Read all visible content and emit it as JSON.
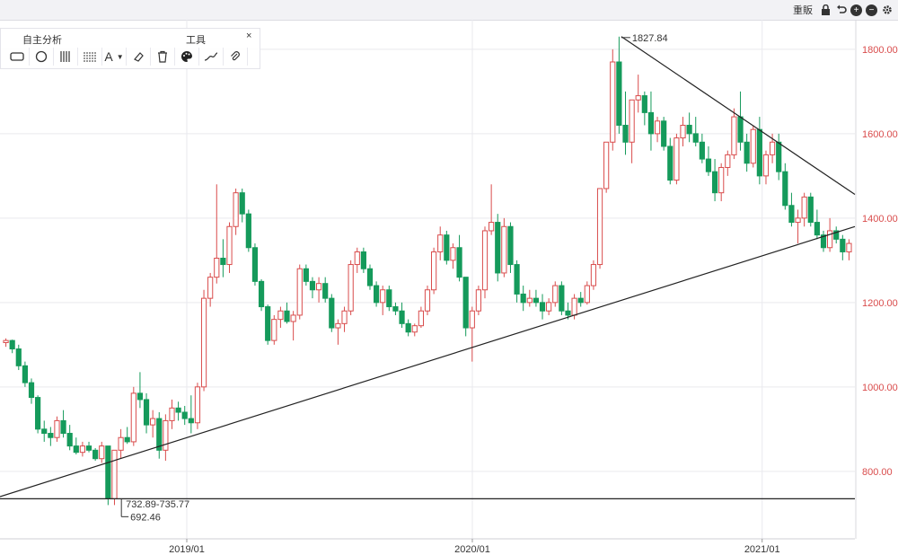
{
  "toolbar": {
    "title": "自主分析",
    "label": "工具",
    "close": "×",
    "tools": [
      {
        "icon": "rectangle-icon"
      },
      {
        "icon": "circle-icon"
      },
      {
        "icon": "vertical-lines-icon"
      },
      {
        "icon": "horizontal-lines-icon"
      },
      {
        "icon": "text-icon",
        "text": "A"
      },
      {
        "icon": "dropdown-arrow-icon",
        "text": "▼"
      },
      {
        "icon": "eraser-icon"
      },
      {
        "icon": "trash-icon"
      },
      {
        "icon": "palette-icon"
      },
      {
        "icon": "line-style-icon"
      },
      {
        "icon": "attach-icon"
      }
    ]
  },
  "topbar": {
    "label": "重販",
    "icons": [
      "lock-icon",
      "undo-icon",
      "zoom-in-icon",
      "zoom-out-icon",
      "settings-icon"
    ]
  },
  "colors": {
    "up": "#d94c4c",
    "down": "#159a5b",
    "axis_text": "#d94c4c",
    "grid": "#e9e9ee",
    "trendline": "#222222"
  },
  "chart_data": {
    "type": "candlestick",
    "x_ticks": [
      "2019/01",
      "2020/01",
      "2021/01"
    ],
    "y_ticks": [
      800,
      1000,
      1200,
      1400,
      1600,
      1800
    ],
    "y_tick_labels": [
      "800.00",
      "1000.00",
      "1200.00",
      "1400.00",
      "1600.00",
      "1800.00"
    ],
    "ylim": [
      640,
      1870
    ],
    "annotations": [
      {
        "text": "1827.84",
        "value": 1827.84,
        "kind": "high"
      },
      {
        "text": "732.89-735.77",
        "value": 734,
        "kind": "horizontal-level"
      },
      {
        "text": "692.46",
        "value": 692.46,
        "kind": "low"
      }
    ],
    "lines": [
      {
        "name": "support-trendline",
        "points": [
          {
            "t": 0,
            "v": 740
          },
          {
            "t": 1,
            "v": 1380
          }
        ]
      },
      {
        "name": "resistance-trendline",
        "points": [
          {
            "t": 0.7268,
            "v": 1830
          },
          {
            "t": 1,
            "v": 1456
          }
        ]
      },
      {
        "name": "horizontal-level",
        "points": [
          {
            "t": 0,
            "v": 735
          },
          {
            "t": 1,
            "v": 735
          }
        ]
      }
    ],
    "candles": [
      [
        1105,
        1115,
        1095,
        1110
      ],
      [
        1110,
        1112,
        1080,
        1090
      ],
      [
        1090,
        1100,
        1040,
        1050
      ],
      [
        1050,
        1060,
        1000,
        1010
      ],
      [
        1010,
        1020,
        960,
        975
      ],
      [
        975,
        980,
        890,
        900
      ],
      [
        900,
        920,
        870,
        890
      ],
      [
        890,
        905,
        860,
        880
      ],
      [
        880,
        930,
        870,
        920
      ],
      [
        920,
        945,
        880,
        890
      ],
      [
        890,
        910,
        850,
        860
      ],
      [
        860,
        880,
        840,
        845
      ],
      [
        845,
        870,
        835,
        860
      ],
      [
        860,
        870,
        845,
        850
      ],
      [
        850,
        855,
        825,
        830
      ],
      [
        830,
        870,
        820,
        860
      ],
      [
        860,
        860,
        720,
        735
      ],
      [
        735,
        850,
        720,
        850
      ],
      [
        850,
        900,
        830,
        880
      ],
      [
        880,
        905,
        865,
        870
      ],
      [
        870,
        1000,
        860,
        985
      ],
      [
        985,
        1035,
        950,
        970
      ],
      [
        970,
        985,
        890,
        910
      ],
      [
        910,
        945,
        880,
        925
      ],
      [
        925,
        940,
        830,
        850
      ],
      [
        850,
        935,
        825,
        920
      ],
      [
        920,
        970,
        900,
        950
      ],
      [
        950,
        965,
        920,
        940
      ],
      [
        940,
        955,
        910,
        925
      ],
      [
        925,
        980,
        890,
        915
      ],
      [
        915,
        1010,
        900,
        1000
      ],
      [
        1000,
        1230,
        990,
        1210
      ],
      [
        1210,
        1270,
        1190,
        1260
      ],
      [
        1260,
        1480,
        1245,
        1305
      ],
      [
        1305,
        1350,
        1260,
        1290
      ],
      [
        1290,
        1390,
        1270,
        1380
      ],
      [
        1380,
        1470,
        1360,
        1460
      ],
      [
        1460,
        1470,
        1390,
        1410
      ],
      [
        1410,
        1420,
        1320,
        1330
      ],
      [
        1330,
        1340,
        1240,
        1250
      ],
      [
        1250,
        1255,
        1180,
        1190
      ],
      [
        1190,
        1195,
        1100,
        1110
      ],
      [
        1110,
        1170,
        1100,
        1160
      ],
      [
        1160,
        1190,
        1140,
        1180
      ],
      [
        1180,
        1200,
        1150,
        1155
      ],
      [
        1155,
        1180,
        1110,
        1170
      ],
      [
        1170,
        1290,
        1160,
        1280
      ],
      [
        1280,
        1290,
        1240,
        1250
      ],
      [
        1250,
        1260,
        1210,
        1230
      ],
      [
        1230,
        1260,
        1200,
        1245
      ],
      [
        1245,
        1260,
        1200,
        1210
      ],
      [
        1210,
        1220,
        1130,
        1140
      ],
      [
        1140,
        1160,
        1100,
        1150
      ],
      [
        1150,
        1190,
        1130,
        1180
      ],
      [
        1180,
        1300,
        1170,
        1290
      ],
      [
        1290,
        1330,
        1270,
        1320
      ],
      [
        1320,
        1330,
        1270,
        1280
      ],
      [
        1280,
        1290,
        1230,
        1240
      ],
      [
        1240,
        1250,
        1190,
        1200
      ],
      [
        1200,
        1240,
        1170,
        1230
      ],
      [
        1230,
        1240,
        1180,
        1190
      ],
      [
        1190,
        1200,
        1170,
        1180
      ],
      [
        1180,
        1200,
        1140,
        1150
      ],
      [
        1150,
        1160,
        1120,
        1130
      ],
      [
        1130,
        1150,
        1120,
        1145
      ],
      [
        1145,
        1190,
        1140,
        1180
      ],
      [
        1180,
        1240,
        1170,
        1230
      ],
      [
        1230,
        1330,
        1220,
        1320
      ],
      [
        1320,
        1380,
        1300,
        1360
      ],
      [
        1360,
        1370,
        1290,
        1300
      ],
      [
        1300,
        1340,
        1280,
        1330
      ],
      [
        1330,
        1360,
        1250,
        1260
      ],
      [
        1260,
        1140,
        1120,
        1140
      ],
      [
        1140,
        1190,
        1060,
        1180
      ],
      [
        1180,
        1240,
        1170,
        1230
      ],
      [
        1230,
        1380,
        1210,
        1370
      ],
      [
        1370,
        1480,
        1360,
        1390
      ],
      [
        1390,
        1410,
        1250,
        1270
      ],
      [
        1270,
        1400,
        1260,
        1380
      ],
      [
        1380,
        1390,
        1270,
        1290
      ],
      [
        1290,
        1300,
        1200,
        1220
      ],
      [
        1220,
        1240,
        1180,
        1200
      ],
      [
        1200,
        1230,
        1190,
        1210
      ],
      [
        1210,
        1230,
        1190,
        1200
      ],
      [
        1200,
        1220,
        1160,
        1180
      ],
      [
        1180,
        1210,
        1170,
        1200
      ],
      [
        1200,
        1250,
        1190,
        1240
      ],
      [
        1240,
        1250,
        1170,
        1180
      ],
      [
        1180,
        1200,
        1160,
        1170
      ],
      [
        1170,
        1220,
        1160,
        1210
      ],
      [
        1210,
        1225,
        1190,
        1200
      ],
      [
        1200,
        1250,
        1195,
        1240
      ],
      [
        1240,
        1300,
        1230,
        1290
      ],
      [
        1290,
        1400,
        1280,
        1470
      ],
      [
        1470,
        1580,
        1460,
        1580
      ],
      [
        1580,
        1800,
        1560,
        1770
      ],
      [
        1770,
        1830,
        1600,
        1620
      ],
      [
        1620,
        1700,
        1550,
        1580
      ],
      [
        1580,
        1680,
        1530,
        1680
      ],
      [
        1680,
        1740,
        1650,
        1690
      ],
      [
        1690,
        1700,
        1620,
        1650
      ],
      [
        1650,
        1700,
        1560,
        1600
      ],
      [
        1600,
        1640,
        1580,
        1630
      ],
      [
        1630,
        1640,
        1560,
        1570
      ],
      [
        1570,
        1590,
        1480,
        1490
      ],
      [
        1490,
        1600,
        1480,
        1590
      ],
      [
        1590,
        1640,
        1570,
        1620
      ],
      [
        1620,
        1650,
        1580,
        1600
      ],
      [
        1600,
        1640,
        1570,
        1580
      ],
      [
        1580,
        1600,
        1530,
        1540
      ],
      [
        1540,
        1570,
        1500,
        1510
      ],
      [
        1510,
        1540,
        1440,
        1460
      ],
      [
        1460,
        1530,
        1440,
        1520
      ],
      [
        1520,
        1560,
        1500,
        1550
      ],
      [
        1550,
        1660,
        1540,
        1640
      ],
      [
        1640,
        1700,
        1560,
        1580
      ],
      [
        1580,
        1600,
        1510,
        1530
      ],
      [
        1530,
        1620,
        1520,
        1610
      ],
      [
        1610,
        1640,
        1480,
        1500
      ],
      [
        1500,
        1560,
        1480,
        1550
      ],
      [
        1550,
        1600,
        1530,
        1580
      ],
      [
        1580,
        1600,
        1490,
        1510
      ],
      [
        1510,
        1530,
        1420,
        1430
      ],
      [
        1430,
        1460,
        1380,
        1390
      ],
      [
        1390,
        1420,
        1340,
        1400
      ],
      [
        1400,
        1460,
        1380,
        1450
      ],
      [
        1450,
        1460,
        1380,
        1390
      ],
      [
        1390,
        1420,
        1350,
        1360
      ],
      [
        1360,
        1370,
        1320,
        1330
      ],
      [
        1330,
        1400,
        1320,
        1370
      ],
      [
        1370,
        1380,
        1340,
        1350
      ],
      [
        1350,
        1360,
        1300,
        1320
      ],
      [
        1320,
        1350,
        1300,
        1340
      ]
    ]
  }
}
